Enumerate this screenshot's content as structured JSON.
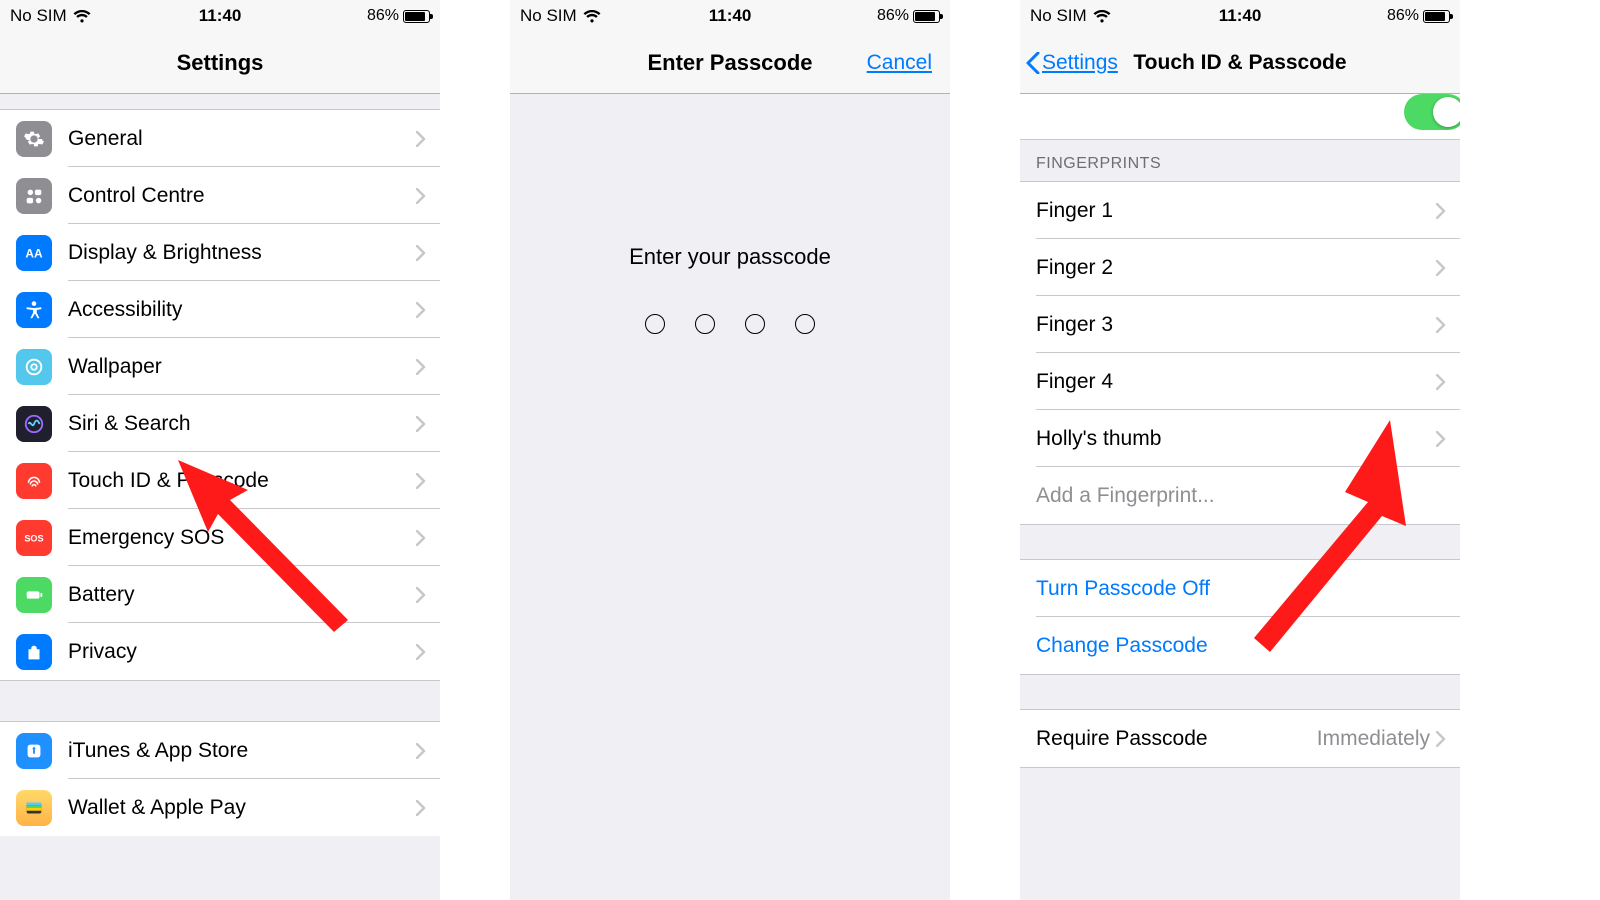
{
  "status": {
    "carrier": "No SIM",
    "time": "11:40",
    "battery_pct": "86%",
    "battery_fill_pct": 86
  },
  "screen1": {
    "title": "Settings",
    "group1": [
      {
        "key": "general",
        "label": "General"
      },
      {
        "key": "control",
        "label": "Control Centre"
      },
      {
        "key": "display",
        "label": "Display & Brightness"
      },
      {
        "key": "access",
        "label": "Accessibility"
      },
      {
        "key": "wall",
        "label": "Wallpaper"
      },
      {
        "key": "siri",
        "label": "Siri & Search"
      },
      {
        "key": "touch",
        "label": "Touch ID & Passcode"
      },
      {
        "key": "sos",
        "label": "Emergency SOS"
      },
      {
        "key": "batt",
        "label": "Battery"
      },
      {
        "key": "priv",
        "label": "Privacy"
      }
    ],
    "group2": [
      {
        "key": "itunes",
        "label": "iTunes & App Store"
      },
      {
        "key": "wallet",
        "label": "Wallet & Apple Pay"
      }
    ]
  },
  "screen2": {
    "title": "Enter Passcode",
    "cancel": "Cancel",
    "prompt": "Enter your passcode",
    "digits": 4
  },
  "screen3": {
    "back": "Settings",
    "title": "Touch ID & Passcode",
    "fingerprints_header": "FINGERPRINTS",
    "fingerprints": [
      "Finger 1",
      "Finger 2",
      "Finger 3",
      "Finger 4",
      "Holly's thumb"
    ],
    "add": "Add a Fingerprint...",
    "turn_off": "Turn Passcode Off",
    "change": "Change Passcode",
    "require_label": "Require Passcode",
    "require_value": "Immediately"
  }
}
